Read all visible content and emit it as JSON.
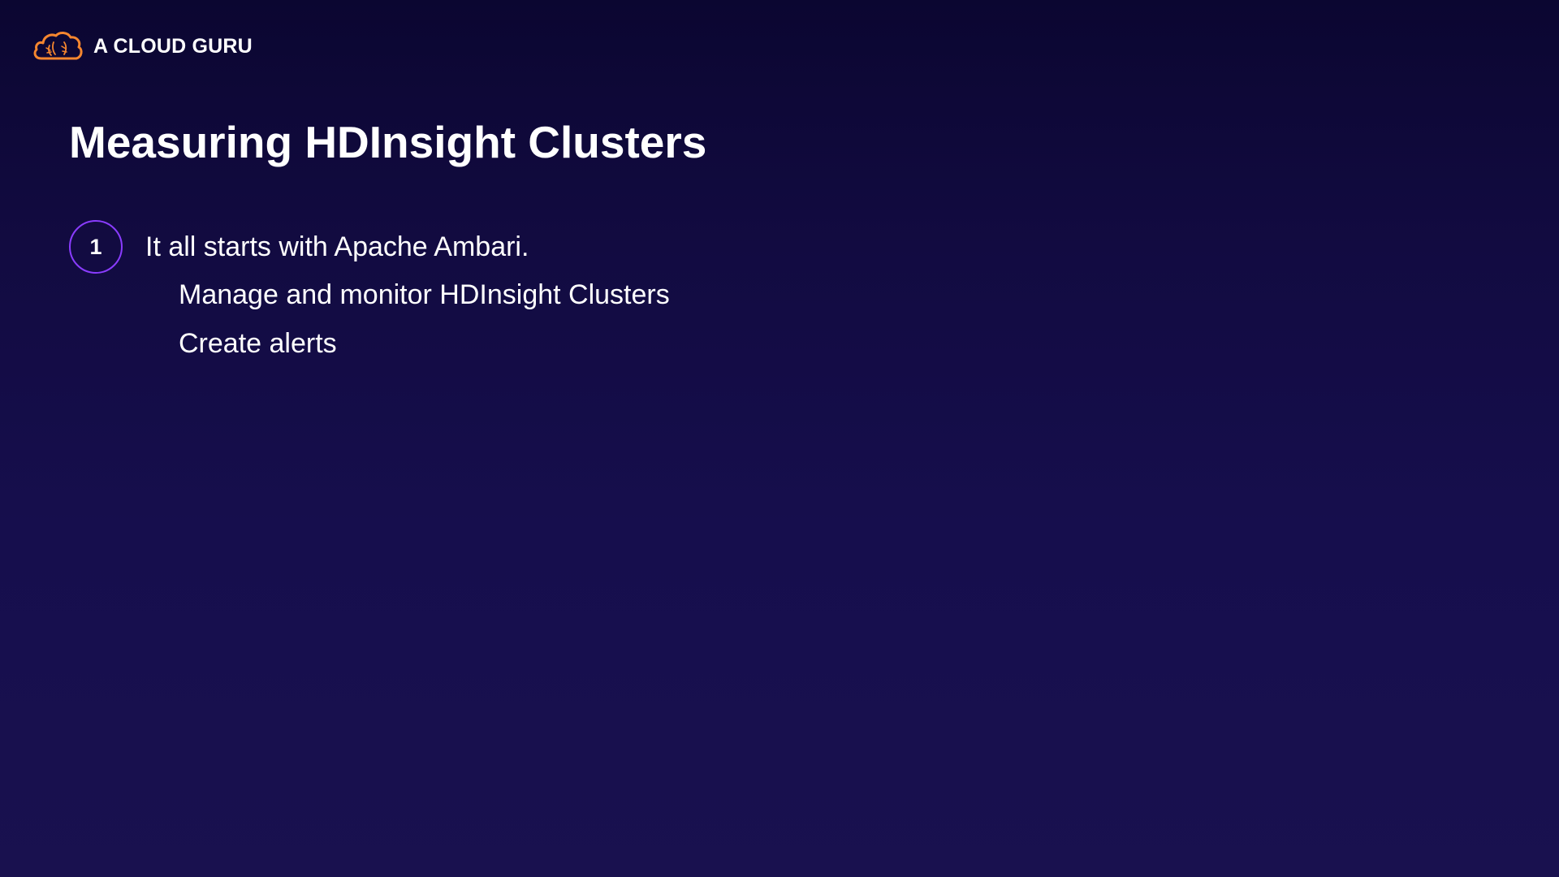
{
  "brand": {
    "logo_icon": "cloud-logo-icon",
    "name": "A CLOUD GURU",
    "accent_color": "#f5862f"
  },
  "slide": {
    "title": "Measuring HDInsight Clusters",
    "points": [
      {
        "number": "1",
        "text": "It all starts with Apache Ambari.",
        "sub_items": [
          "Manage and monitor HDInsight Clusters",
          "Create alerts"
        ]
      }
    ]
  },
  "colors": {
    "background_top": "#0b0631",
    "background_bottom": "#19114f",
    "number_ring": "#8a3cff",
    "text": "#ffffff"
  }
}
